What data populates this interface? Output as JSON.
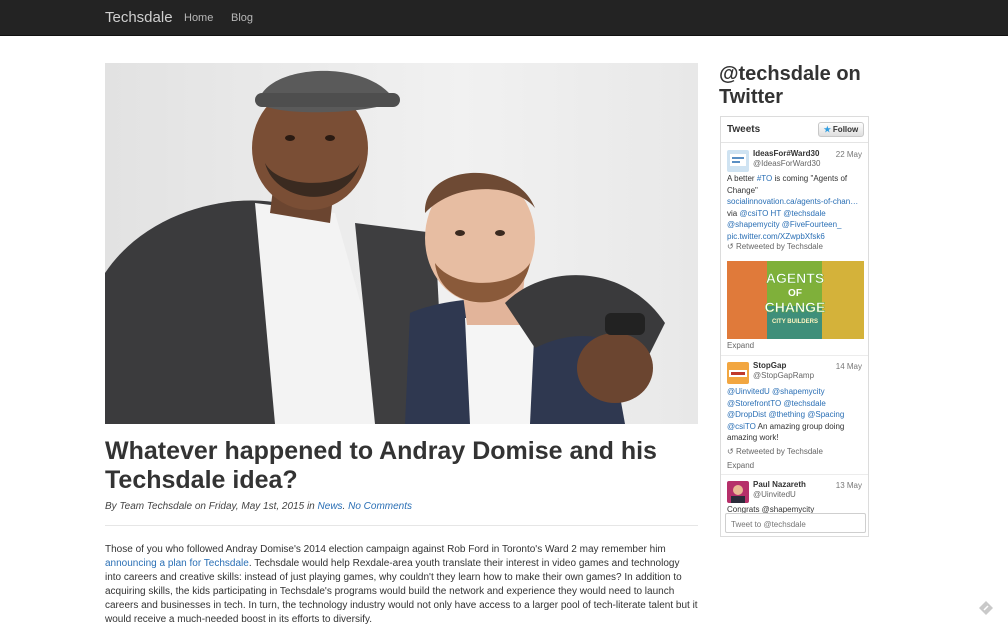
{
  "navbar": {
    "brand": "Techsdale",
    "links": [
      "Home",
      "Blog"
    ]
  },
  "post": {
    "title": "Whatever happened to Andray Domise and his Techsdale idea?",
    "byline": {
      "prefix": "By Team Techsdale on Friday, May 1st, 2015 in",
      "category": "News",
      "separator": ".",
      "comments": "No Comments"
    },
    "body": {
      "intro": "Those of you who followed Andray Domise's 2014 election campaign against Rob Ford in Toronto's Ward 2 may remember him",
      "link": "announcing a plan for Techsdale",
      "rest": ". Techsdale would help Rexdale-area youth translate their interest in video games and technology into careers and creative skills: instead of just playing games, why couldn't they learn how to make their own games? In addition to acquiring skills, the kids participating in Techsdale's programs would build the network and experience they would need to launch careers and businesses in tech. In turn, the technology industry would not only have access to a larger pool of tech-literate talent but it would receive a much-needed boost in its efforts to diversify."
    }
  },
  "sidebar": {
    "title": "@techsdale on Twitter"
  },
  "twitter": {
    "heading": "Tweets",
    "follow": "Follow",
    "retweeted": "Retweeted by Techsdale",
    "expand": "Expand",
    "tweets": [
      {
        "name": "IdeasFor#Ward30",
        "handle": "@IdeasForWard30",
        "date": "22 May",
        "text_lead": "A better",
        "hashtag": "#TO",
        "text_trail": "is coming \"Agents of Change\"",
        "link": "socialinnovation.ca/agents-of-chan…",
        "via_prefix": "via",
        "mentions": "@csiTO HT @techsdale",
        "mentions2": "@shapemycity @FiveFourteen_",
        "pic": "pic.twitter.com/XZwpbXfsk6"
      },
      {
        "name": "StopGap",
        "handle": "@StopGapRamp",
        "date": "14 May",
        "line1": "@UinvitedU @shapemycity",
        "line2": "@StorefrontTO @techsdale",
        "line3": "@DropDist @thething @Spacing",
        "line4_mention": "@csiTO",
        "line4_text": "An amazing group doing",
        "line5": "amazing work!"
      },
      {
        "name": "Paul Nazareth",
        "handle": "@UinvitedU",
        "date": "13 May",
        "partial": "Congrats @shapemycity"
      }
    ],
    "media": {
      "line1": "AGENTS",
      "line2": "OF",
      "line3": "CHANGE",
      "line4": "CITY BUILDERS"
    },
    "tweet_box_placeholder": "Tweet to @techsdale"
  },
  "colors": {
    "navbar_bg": "#232323",
    "link": "#2a6fb5",
    "twitter_blue": "#2f9de0"
  },
  "icons": [
    "twitter-bird-icon",
    "retweet-icon",
    "edit-corner-icon"
  ]
}
